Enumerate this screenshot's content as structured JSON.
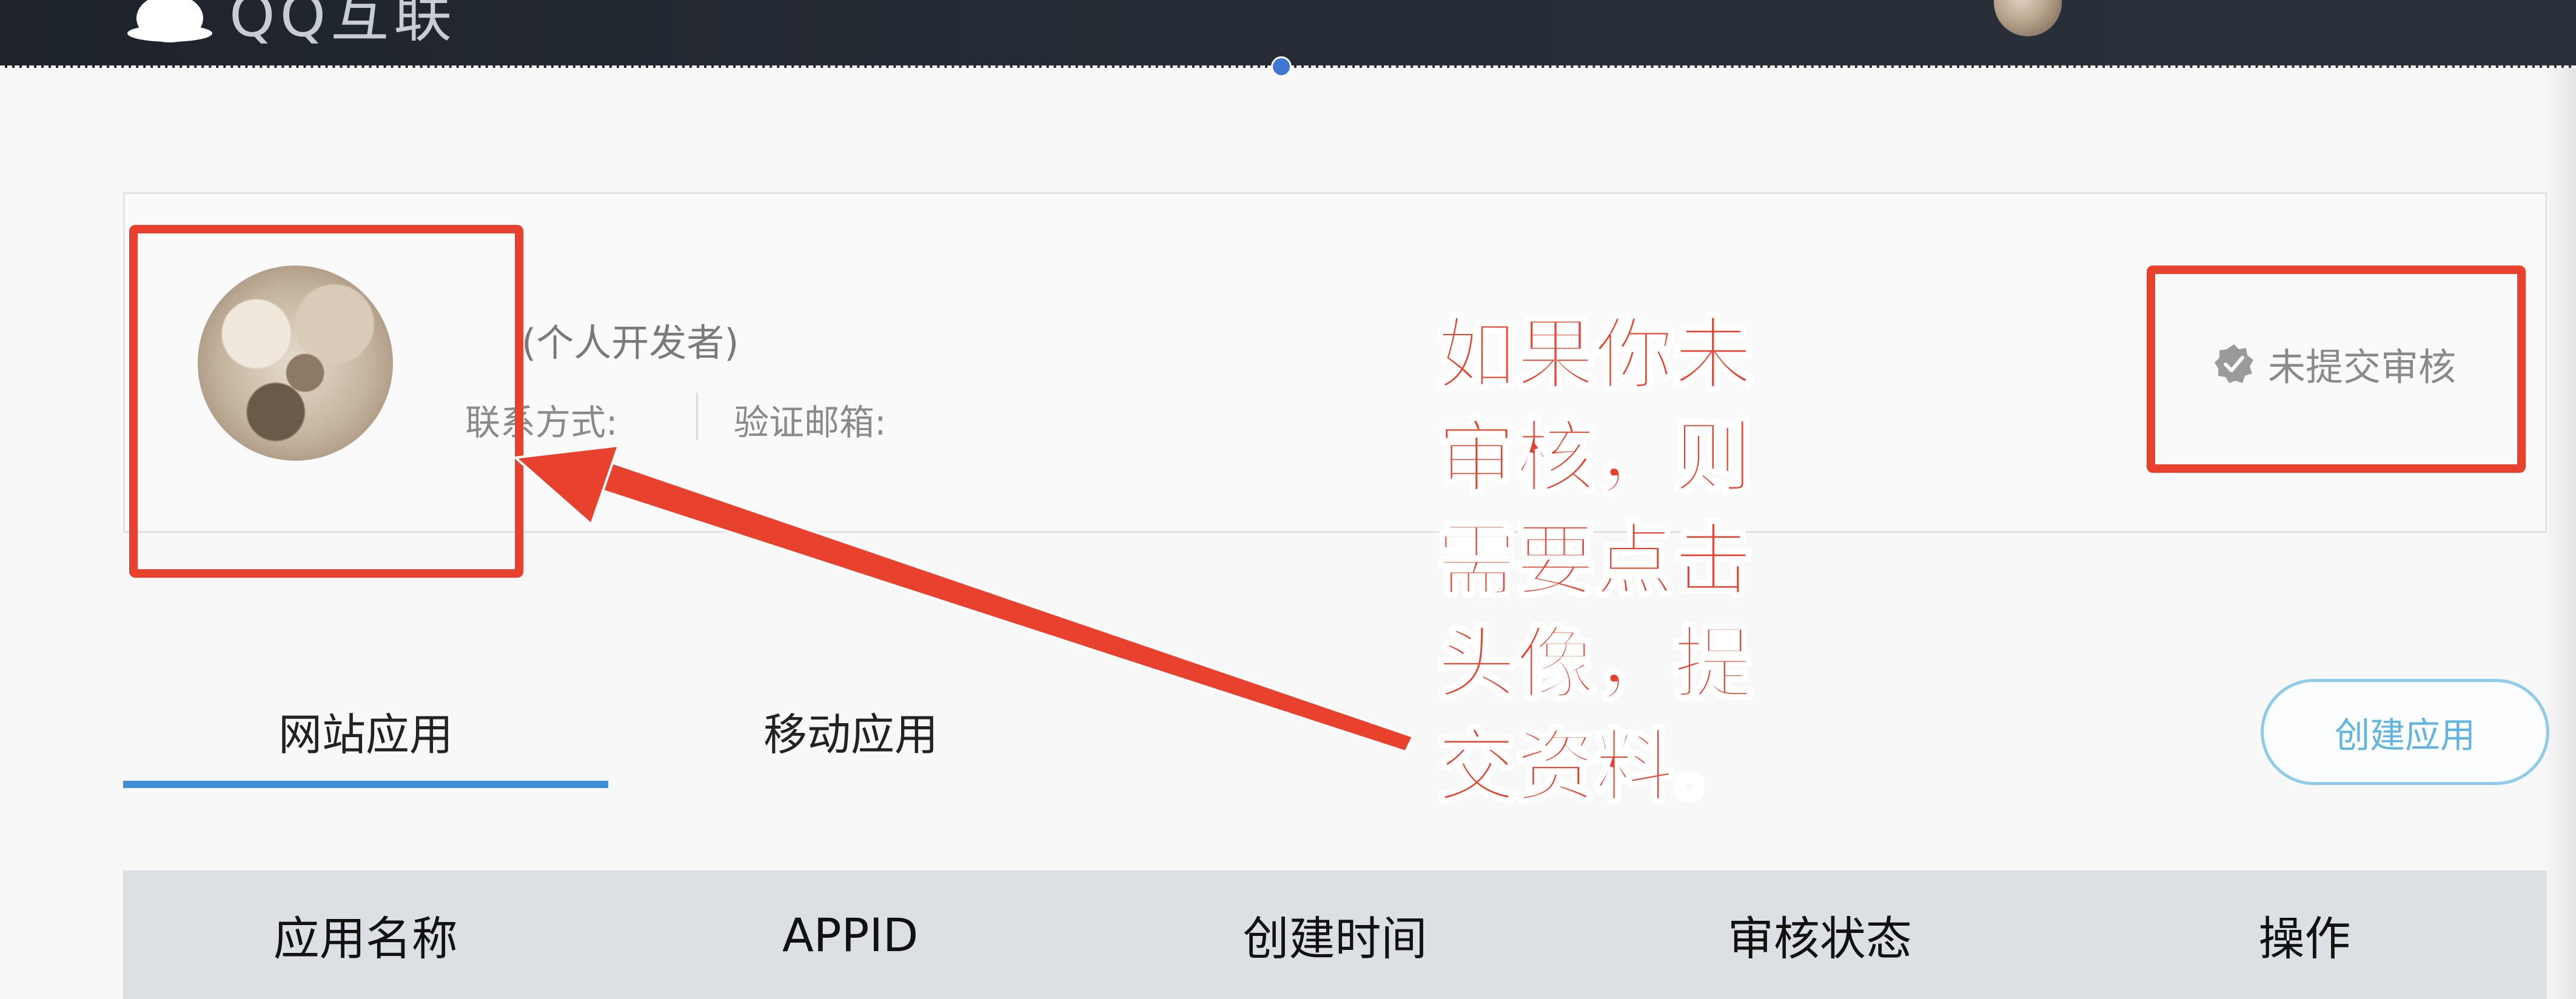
{
  "header": {
    "brand": "QQ互联",
    "avatar_icon": "user-avatar-icon"
  },
  "profile": {
    "developer_type": "(个人开发者)",
    "contact_label": "联系方式:",
    "email_label": "验证邮箱:",
    "review_status": "未提交审核"
  },
  "annotation": {
    "text": "如果你未审核，则需要点击头像，提交资料。",
    "color": "#e8412e"
  },
  "tabs": [
    {
      "label": "网站应用",
      "active": true
    },
    {
      "label": "移动应用",
      "active": false
    }
  ],
  "create_button": "创建应用",
  "table": {
    "headers": [
      "应用名称",
      "APPID",
      "创建时间",
      "审核状态",
      "操作"
    ]
  },
  "colors": {
    "accent": "#3f8fd6",
    "annotation_red": "#e8412e",
    "button_outline": "#8fcbea"
  }
}
